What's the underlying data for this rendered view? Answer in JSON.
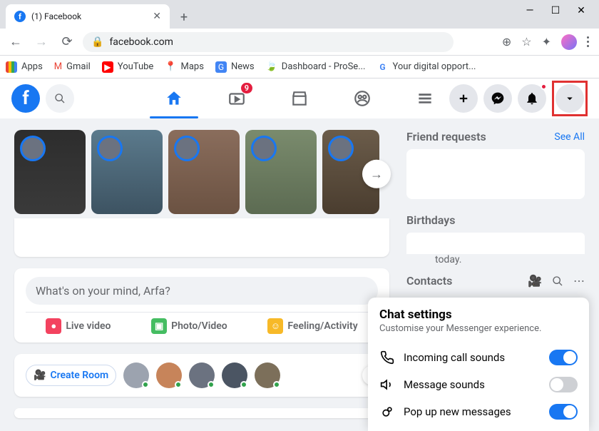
{
  "browser": {
    "tab_title": "(1) Facebook",
    "url": "facebook.com",
    "bookmarks": {
      "apps": "Apps",
      "gmail": "Gmail",
      "youtube": "YouTube",
      "maps": "Maps",
      "news": "News",
      "dashboard": "Dashboard - ProSe...",
      "digital": "Your digital opport..."
    }
  },
  "fb": {
    "watch_badge": "9",
    "composer_placeholder": "What's on your mind, Arfa?",
    "actions": {
      "live": "Live video",
      "photo": "Photo/Video",
      "feeling": "Feeling/Activity"
    },
    "create_room": "Create Room",
    "side": {
      "friend_requests": "Friend requests",
      "see_all": "See All",
      "birthdays": "Birthdays",
      "birthday_text": "today.",
      "contacts": "Contacts"
    },
    "chat": {
      "title": "Chat settings",
      "subtitle": "Customise your Messenger experience.",
      "rows": {
        "incoming": "Incoming call sounds",
        "message": "Message sounds",
        "popup": "Pop up new messages"
      }
    }
  }
}
